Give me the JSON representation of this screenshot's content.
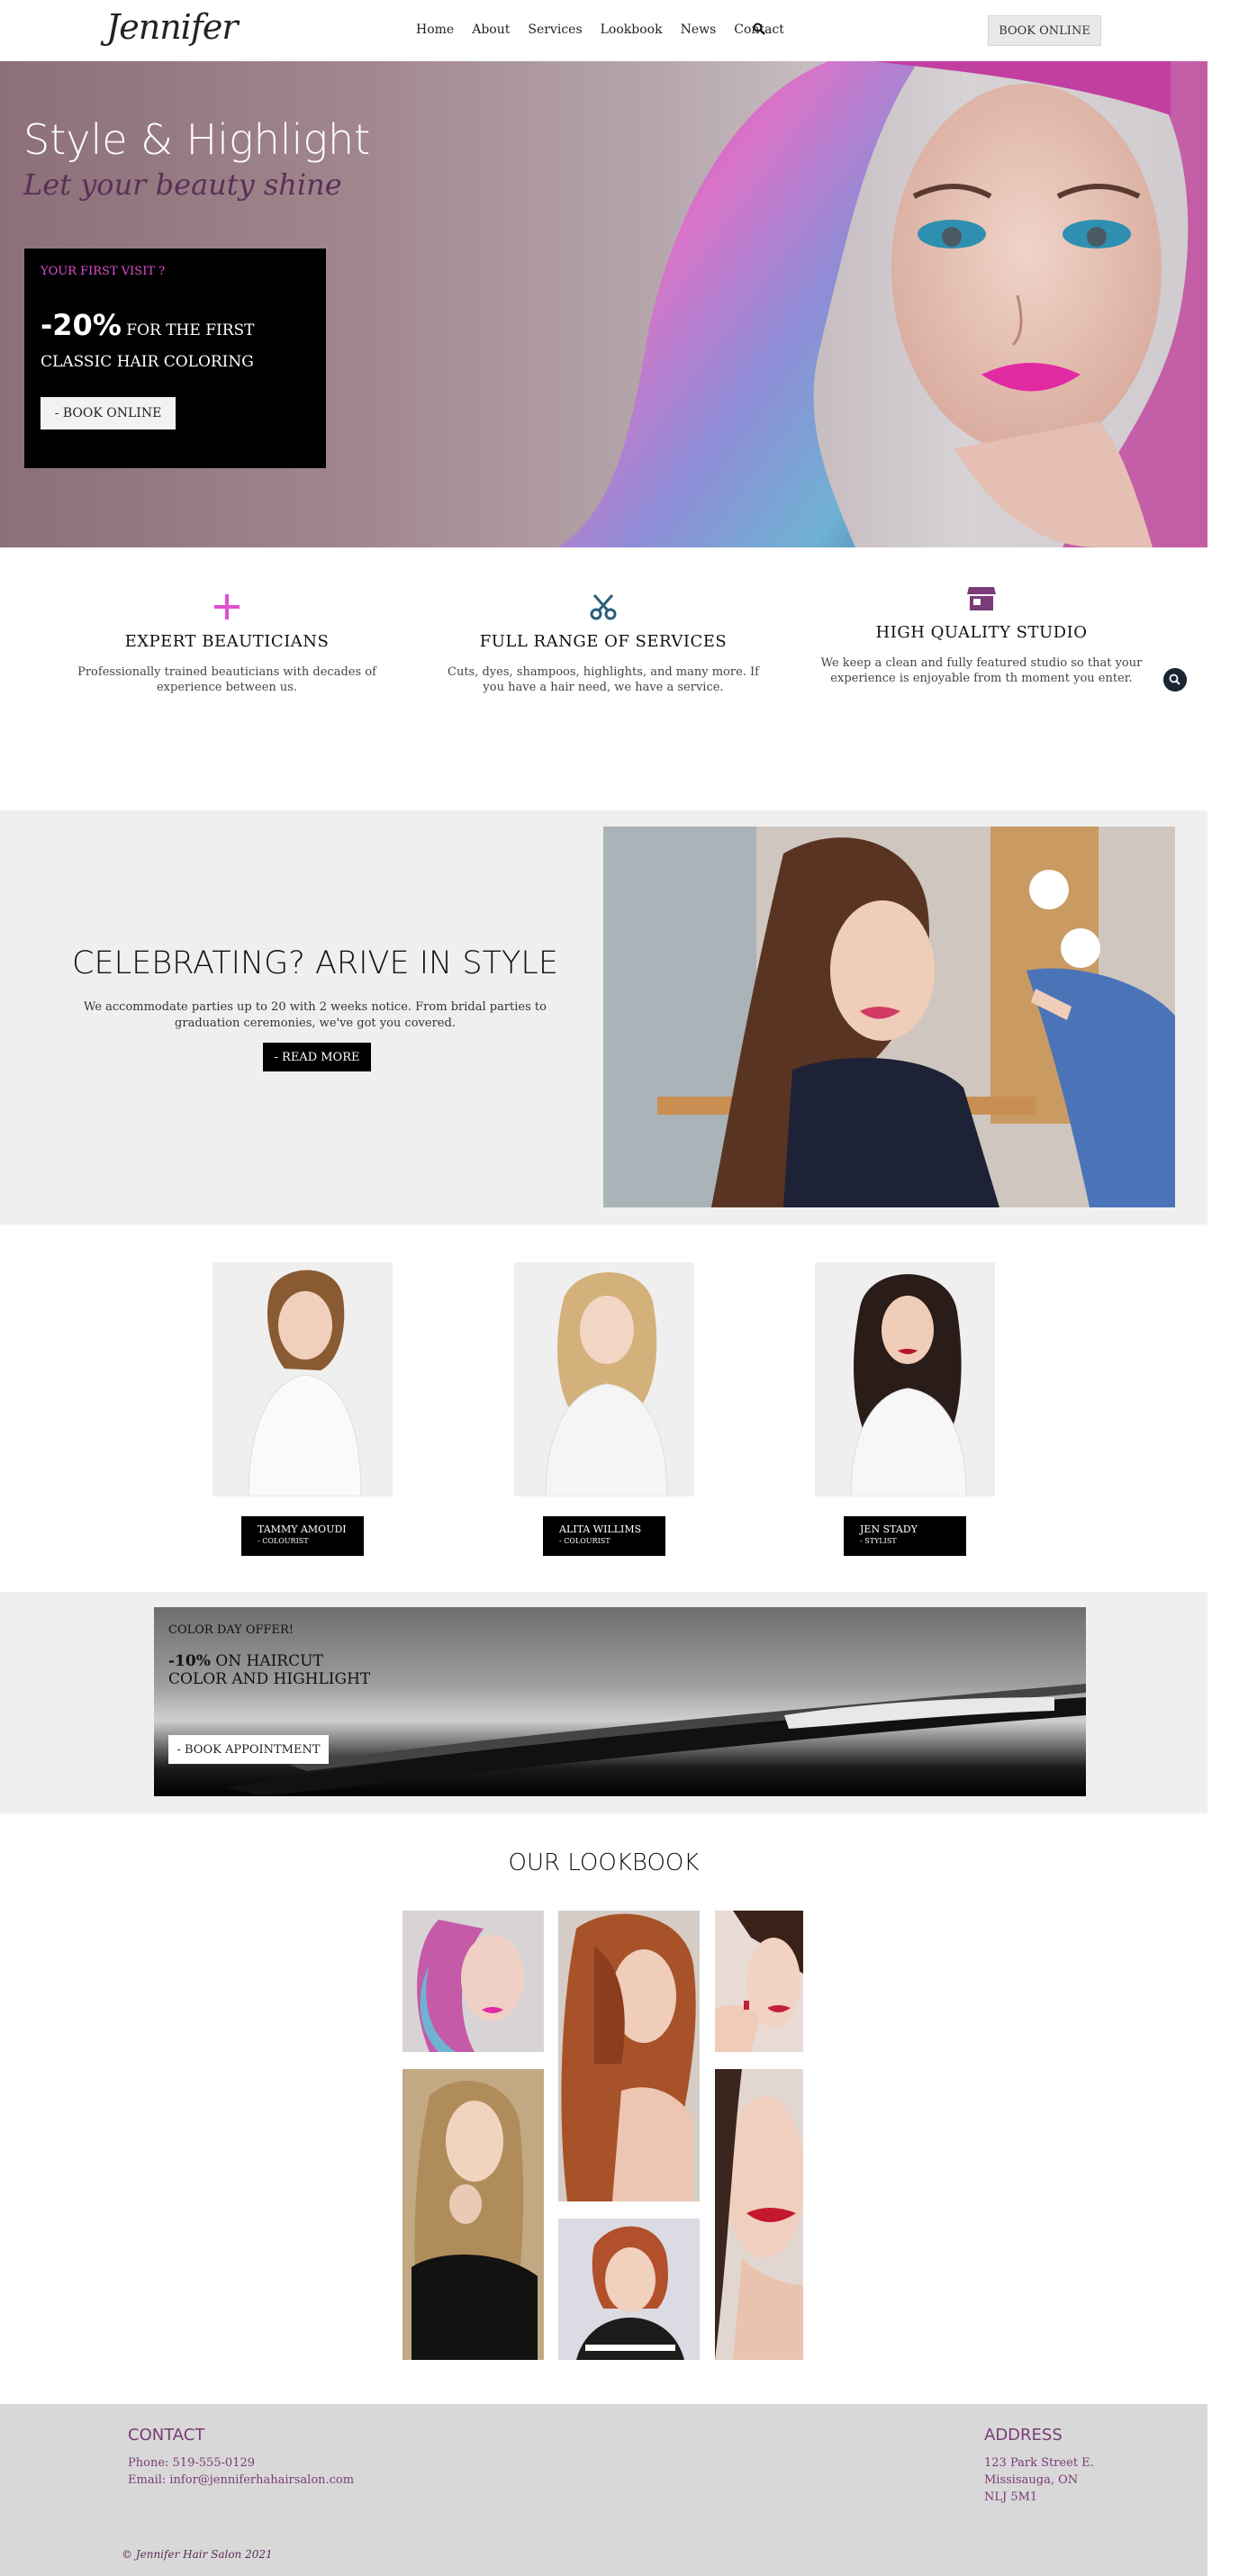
{
  "nav": {
    "logo": "Jennifer",
    "links": [
      "Home",
      "About",
      "Services",
      "Lookbook",
      "News",
      "Contact"
    ],
    "search_icon": "search-icon",
    "book_label": "BOOK ONLINE"
  },
  "hero": {
    "title": "Style & Highlight",
    "subtitle": "Let your beauty shine",
    "offer_kicker": "YOUR FIRST VISIT ?",
    "offer_percent": "-20%",
    "offer_text": " FOR THE FIRST CLASSIC HAIR COLORING",
    "offer_button": "- BOOK ONLINE"
  },
  "features": [
    {
      "icon": "plus-icon",
      "title": "EXPERT BEAUTICIANS",
      "text": "Professionally trained beauticians with decades of experience between us."
    },
    {
      "icon": "scissors-icon",
      "title": "FULL RANGE OF SERVICES",
      "text": "Cuts, dyes, shampoos, highlights, and many more. If you have a hair need, we have a service."
    },
    {
      "icon": "store-icon",
      "title": "HIGH QUALITY STUDIO",
      "text": "We keep a clean and fully featured studio so that your experience is enjoyable from th moment you enter."
    }
  ],
  "celebrate": {
    "title": "CELEBRATING? ARIVE IN STYLE",
    "text": "We accommodate parties up to 20 with 2 weeks notice. From bridal parties to graduation ceremonies, we've got you covered.",
    "button": "- READ MORE"
  },
  "team": [
    {
      "name": "TAMMY AMOUDI",
      "role": "- COLOURIST"
    },
    {
      "name": "ALITA WILLIMS",
      "role": "- COLOURIST"
    },
    {
      "name": "JEN STADY",
      "role": "- STYLIST"
    }
  ],
  "promo": {
    "kicker": "COLOR DAY OFFER!",
    "percent": "-10%",
    "text": " ON HAIRCUT COLOR AND HIGHLIGHT",
    "button": "- BOOK APPOINTMENT"
  },
  "lookbook": {
    "title": "OUR LOOKBOOK"
  },
  "footer": {
    "contact_heading": "CONTACT",
    "phone": "Phone: 519-555-0129",
    "email": "Email: infor@jenniferhahairsalon.com",
    "address_heading": "ADDRESS",
    "address_line1": "123 Park Street E.",
    "address_line2": "Missisauga, ON",
    "address_line3": "NLJ 5M1",
    "copyright": "© Jennifer Hair Salon 2021"
  },
  "colors": {
    "accent": "#e04fd0",
    "purple": "#7a3b78",
    "scissors": "#2c5d7c"
  }
}
